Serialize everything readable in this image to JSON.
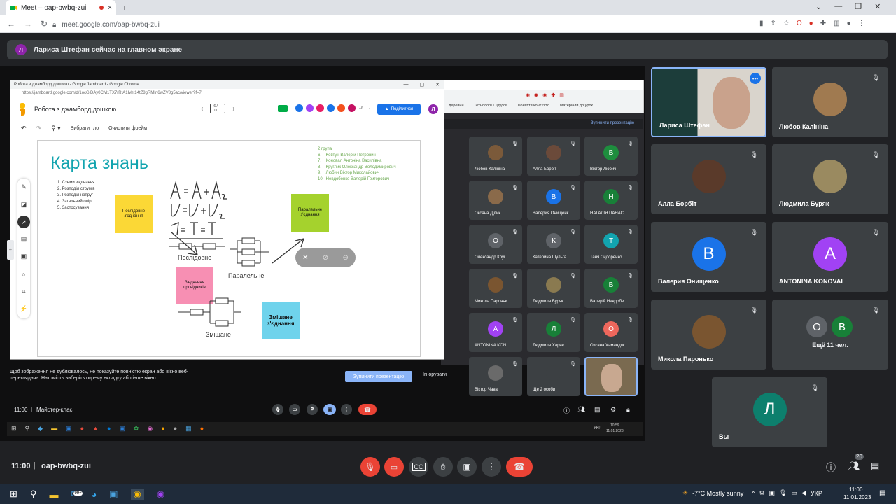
{
  "browser": {
    "tab_title": "Meet – oap-bwbq-zui",
    "url": "meet.google.com/oap-bwbq-zui"
  },
  "banner": {
    "initial": "Л",
    "text": "Лариса Штефан сейчас на главном экране"
  },
  "jamboard": {
    "window_title": "Робота з джамборд дошкою - Google Jamboard - Google Chrome",
    "url": "https://jamboard.google.com/d/1ocGlDAy0CM1TX7rRtA1Ivht14tZ8gRMIn6wZV8g5ac/viewer?f=7",
    "doc_title": "Робота з джамборд дошкою",
    "frame_counter": "6 / 11",
    "share_label": "Поділитися",
    "user_initial": "Л",
    "more_count": "+6",
    "toolbar": {
      "bg_label": "Вибрати тло",
      "clear_label": "Очистити фрейм"
    },
    "board": {
      "title": "Карта знань",
      "topics": [
        "1. Схеми з'єднання",
        "2. Розподіл струмів",
        "3. Розподіл напруг",
        "4. Загальний опір",
        "5. Застосування"
      ],
      "group_header": "2 група",
      "group_members": [
        "6.    Ковтун Валерій Петрович",
        "7.    Коновал Антоніна Василівна",
        "8.    Круглик Олександр Володимирович",
        "9.    Любич Віктор Миколайович",
        "10.  Невдобенко Валерій Григорович"
      ],
      "sticky_serial": "Послідовне з'єднання",
      "sticky_parallel": "Паралельне з'єднання",
      "sticky_mixed": "З'єднання провідників",
      "sticky_combined": "Змішане з'єднання",
      "label_serial": "Послідовне",
      "label_parallel": "Паралельне",
      "label_mixed": "Змішане"
    }
  },
  "share_notice": {
    "text": "Щоб зображення не дублювалось, не показуйте повністю екран або вікно веб-переглядача. Натомість виберіть окрему вкладку або інше вікно.",
    "stop_label": "Зупинити презентацію",
    "ignore_label": "Ігнорувати",
    "inner_stop_label": "Зупинити презентацію"
  },
  "inner_bookmarks": [
    "... деревин...",
    "Технології і Трудов...",
    "Поняття конт'єкто...",
    "Матеріали до урок..."
  ],
  "inner_meeting": {
    "time": "11:00",
    "title": "Майстер-клас"
  },
  "inner_tiles": [
    {
      "name": "Любов Калініна",
      "initial": "",
      "color": "#7b5a3a"
    },
    {
      "name": "Алла Борбіт",
      "initial": "",
      "color": "#6b4a3a"
    },
    {
      "name": "Віктор Любич",
      "initial": "В",
      "color": "#1e8e3e"
    },
    {
      "name": "Оксана Дідик",
      "initial": "",
      "color": "#8a6a4a"
    },
    {
      "name": "Валерия Онищенк...",
      "initial": "В",
      "color": "#1a73e8"
    },
    {
      "name": "НАТАЛІЯ ПАНАС...",
      "initial": "Н",
      "color": "#188038"
    },
    {
      "name": "Олександр Круг...",
      "initial": "О",
      "color": "#5f6368"
    },
    {
      "name": "Катерина Шульга",
      "initial": "К",
      "color": "#5f6368"
    },
    {
      "name": "Таня Сидоренко",
      "initial": "Т",
      "color": "#12a4af"
    },
    {
      "name": "Микола Пароньк...",
      "initial": "",
      "color": "#7a5530"
    },
    {
      "name": "Людмила Буряк",
      "initial": "",
      "color": "#8a7a50"
    },
    {
      "name": "Валерій Невдобе...",
      "initial": "В",
      "color": "#188038"
    },
    {
      "name": "ANTONINA KON...",
      "initial": "А",
      "color": "#a142f4"
    },
    {
      "name": "Людмила Харче...",
      "initial": "Л",
      "color": "#188038"
    },
    {
      "name": "Оксана Хамандяк",
      "initial": "О",
      "color": "#ee675c"
    },
    {
      "name": "Віктор Чава",
      "initial": "",
      "color": "#6a6a6a"
    },
    {
      "name": "Ще 2 особи",
      "initial": "",
      "color": "#3c4043"
    }
  ],
  "inner_taskbar": {
    "time": "10:59",
    "date": "11.01.2023",
    "lang": "УКР"
  },
  "tiles": [
    {
      "name": "Лариса Штефан",
      "initial": "",
      "color": "#6b5a40"
    },
    {
      "name": "Любов Калініна",
      "initial": "",
      "color": "#a07a50"
    },
    {
      "name": "Алла Борбіт",
      "initial": "",
      "color": "#5a3a2a"
    },
    {
      "name": "Людмила Буряк",
      "initial": "",
      "color": "#9a8a60"
    },
    {
      "name": "Валерия Онищенко",
      "initial": "В",
      "color": "#1a73e8"
    },
    {
      "name": "ANTONINA KONOVAL",
      "initial": "A",
      "color": "#a142f4"
    },
    {
      "name": "Микола Паронько",
      "initial": "",
      "color": "#7a5530"
    },
    {
      "name": "Ещё 11 чел.",
      "initial": "О",
      "initial2": "В",
      "color": "#5f6368",
      "color2": "#188038"
    },
    {
      "name": "Вы",
      "initial": "Л",
      "color": "#0d7f6d"
    }
  ],
  "bottom": {
    "time": "11:00",
    "code": "oap-bwbq-zui",
    "participant_count": "20"
  },
  "taskbar": {
    "weather": "-7°C  Mostly sunny",
    "lang": "УКР",
    "time": "11:00",
    "date": "11.01.2023",
    "badge": "99+"
  },
  "colors": {
    "end_call": "#ea4335",
    "accent": "#8ab4f8",
    "tile": "#3c4043"
  }
}
